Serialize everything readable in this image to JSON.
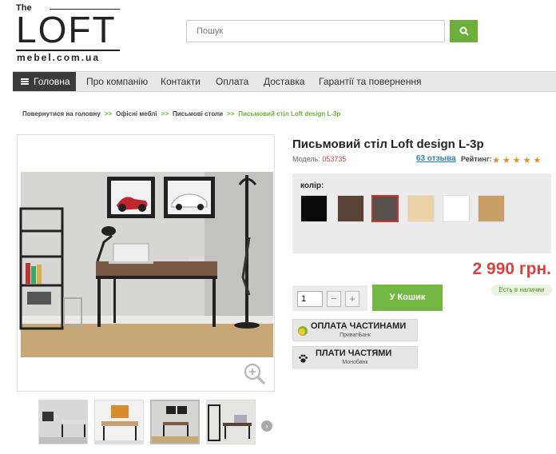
{
  "header": {
    "logo": {
      "the": "The",
      "brand": "LOFT",
      "domain": "mebel.com.ua"
    },
    "search": {
      "placeholder": "Пошук"
    }
  },
  "nav": {
    "items": [
      {
        "label": "Головна"
      },
      {
        "label": "Про компанію"
      },
      {
        "label": "Контакти"
      },
      {
        "label": "Оплата"
      },
      {
        "label": "Доставка"
      },
      {
        "label": "Гарантії та повернення"
      }
    ]
  },
  "breadcrumb": {
    "items": [
      "Повернутися на головну",
      "Офісні меблі",
      "Письмові столи",
      "Письмовий стіл Loft design L-3p"
    ],
    "separator": ">>"
  },
  "product": {
    "title": "Письмовий стіл Loft design L-3p",
    "model_label": "Модель:",
    "model_code": "053735",
    "reviews": "63 отзыва",
    "rating_label": "Рейтинг:",
    "rating": 5,
    "color_label": "колір:",
    "colors": [
      {
        "name": "black",
        "hex": "#0b0b0b",
        "selected": false
      },
      {
        "name": "dark-walnut",
        "hex": "#5a4334",
        "selected": false
      },
      {
        "name": "graphite-oak",
        "hex": "#58514b",
        "selected": true
      },
      {
        "name": "light-beech",
        "hex": "#ecd3a6",
        "selected": false
      },
      {
        "name": "white",
        "hex": "#ffffff",
        "selected": false
      },
      {
        "name": "sonoma-oak",
        "hex": "#c9a065",
        "selected": false
      }
    ],
    "price": "2 990 грн.",
    "stock": "Есть в наличии",
    "quantity": "1",
    "minus": "−",
    "plus": "+",
    "cart_label": "У Кошик",
    "payments": [
      {
        "title": "ОПЛАТА ЧАСТИНАМИ",
        "bank": "ПриватБанк",
        "icon": "privat-coin-icon"
      },
      {
        "title": "ПЛАТИ ЧАСТЯМИ",
        "bank": "Монобанк",
        "icon": "paw-icon"
      }
    ]
  },
  "colors": {
    "accent": "#6bb03a",
    "price": "#d9413f",
    "nav_active": "#3b3b3b"
  }
}
